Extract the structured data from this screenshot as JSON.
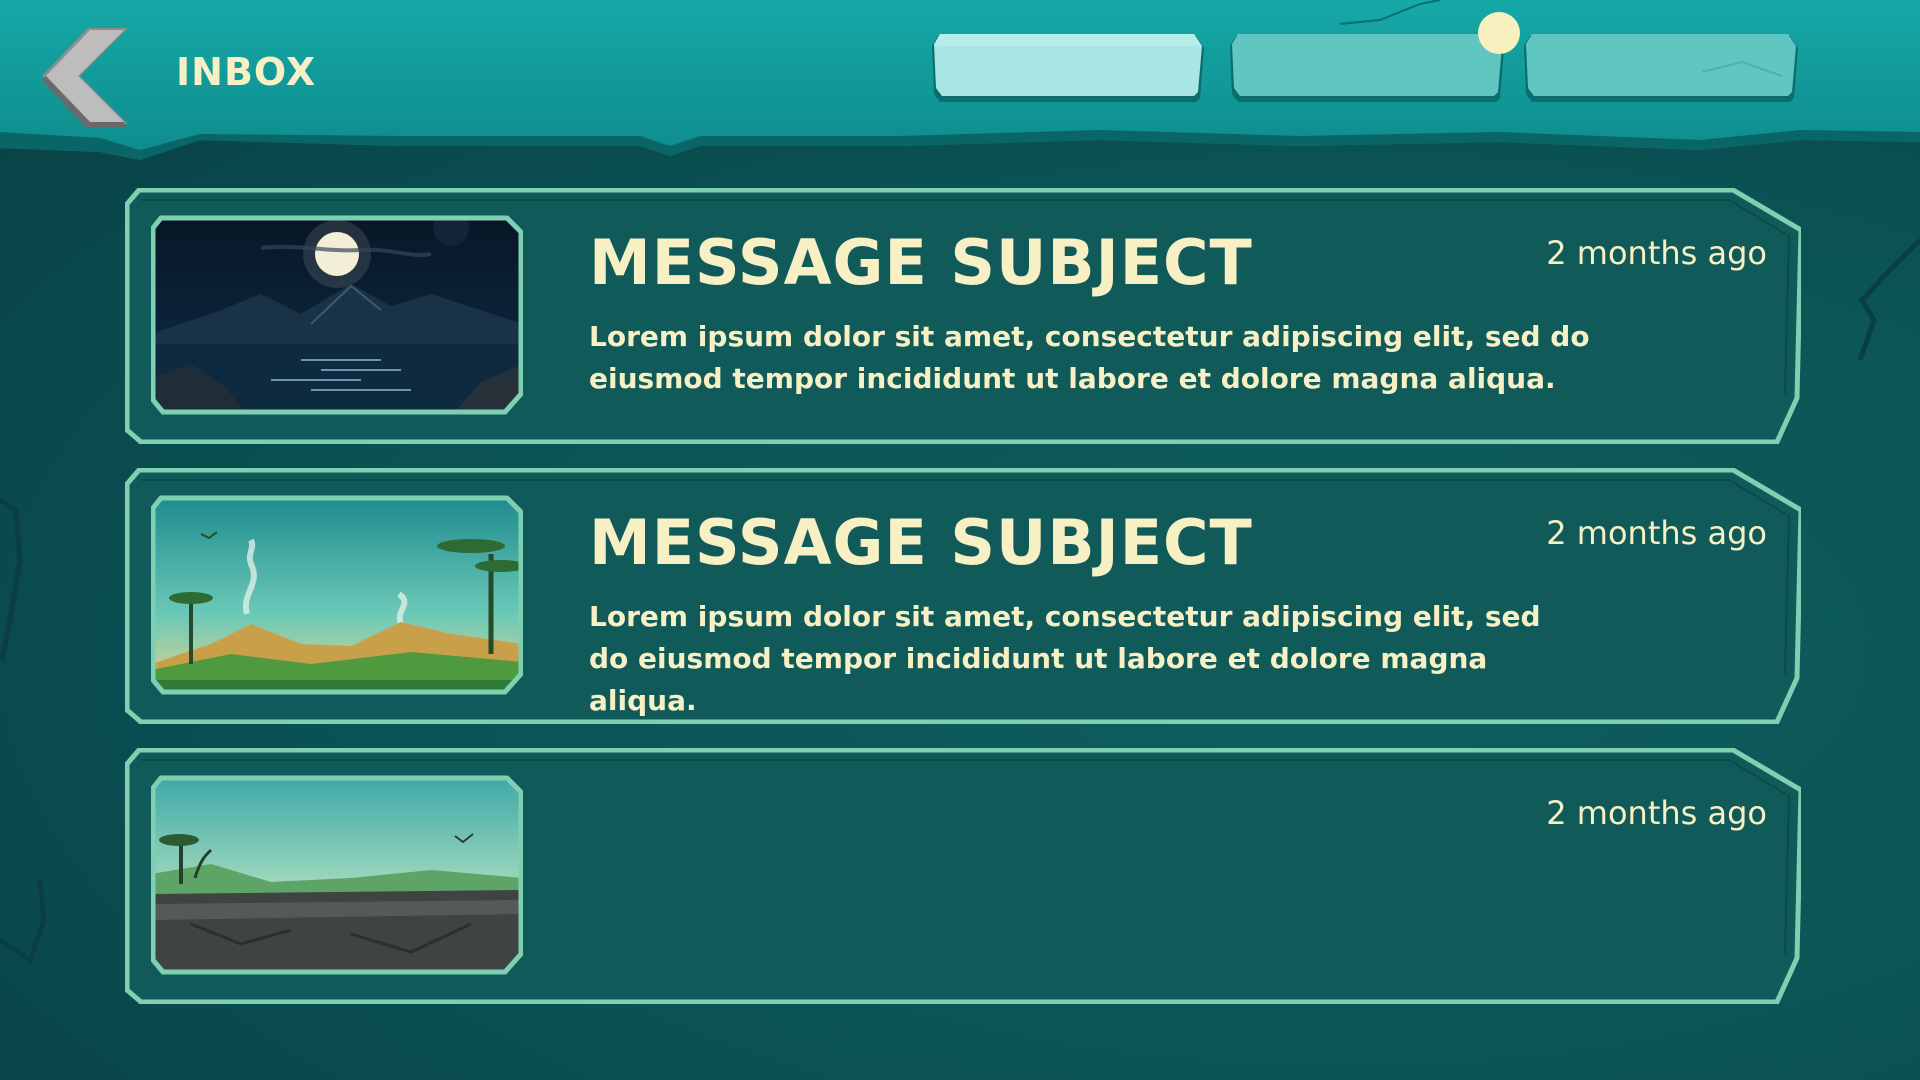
{
  "header": {
    "title": "INBOX",
    "tabs": [
      {
        "label": ""
      },
      {
        "label": ""
      },
      {
        "label": ""
      }
    ],
    "has_notification": true
  },
  "messages": [
    {
      "subject": "MESSAGE SUBJECT",
      "time": "2 months ago",
      "body": "Lorem ipsum dolor sit amet, consectetur adipiscing elit, sed do eiusmod tempor incididunt ut labore et dolore magna aliqua.",
      "image": "night-mountain-lake"
    },
    {
      "subject": "MESSAGE SUBJECT",
      "time": "2 months ago",
      "body": "Lorem ipsum dolor sit amet, consectetur adipiscing elit, sed do eiusmod tempor incididunt ut labore et dolore magna aliqua.",
      "image": "savanna-volcano-sunrise"
    },
    {
      "subject": "",
      "time": "2 months ago",
      "body": "",
      "image": "rocky-plain-dinosaurs"
    }
  ],
  "colors": {
    "text": "#f6f0c4",
    "frame": "#7fcfb3",
    "card_bg": "#115a5a",
    "header_bg": "#15a3a3"
  }
}
